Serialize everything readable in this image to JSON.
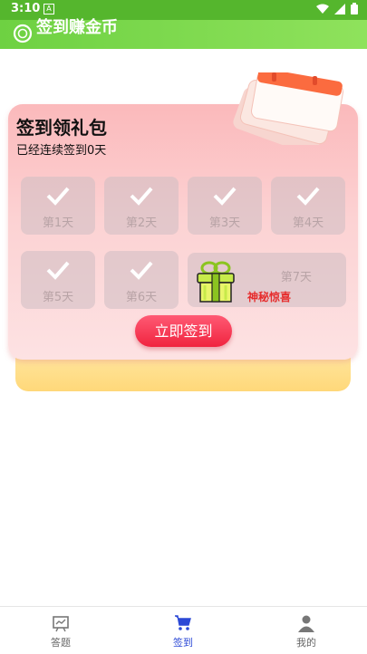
{
  "status_bar": {
    "time": "3:10",
    "notification_icon": "A"
  },
  "app_bar": {
    "title": "签到赚金币"
  },
  "checkin": {
    "title": "签到领礼包",
    "subtitle": "已经连续签到0天",
    "days": [
      "第1天",
      "第2天",
      "第3天",
      "第4天",
      "第5天",
      "第6天",
      "第7天"
    ],
    "surprise": "神秘惊喜",
    "button": "立即签到"
  },
  "nav": {
    "items": [
      {
        "label": "答题",
        "icon": "quiz-icon"
      },
      {
        "label": "签到",
        "icon": "cart-icon"
      },
      {
        "label": "我的",
        "icon": "person-icon"
      }
    ],
    "active_color": "#2c49d6"
  },
  "colors": {
    "accent_green": "#55b62d",
    "button_red": "#f0243f",
    "surprise_red": "#e62b2b"
  }
}
